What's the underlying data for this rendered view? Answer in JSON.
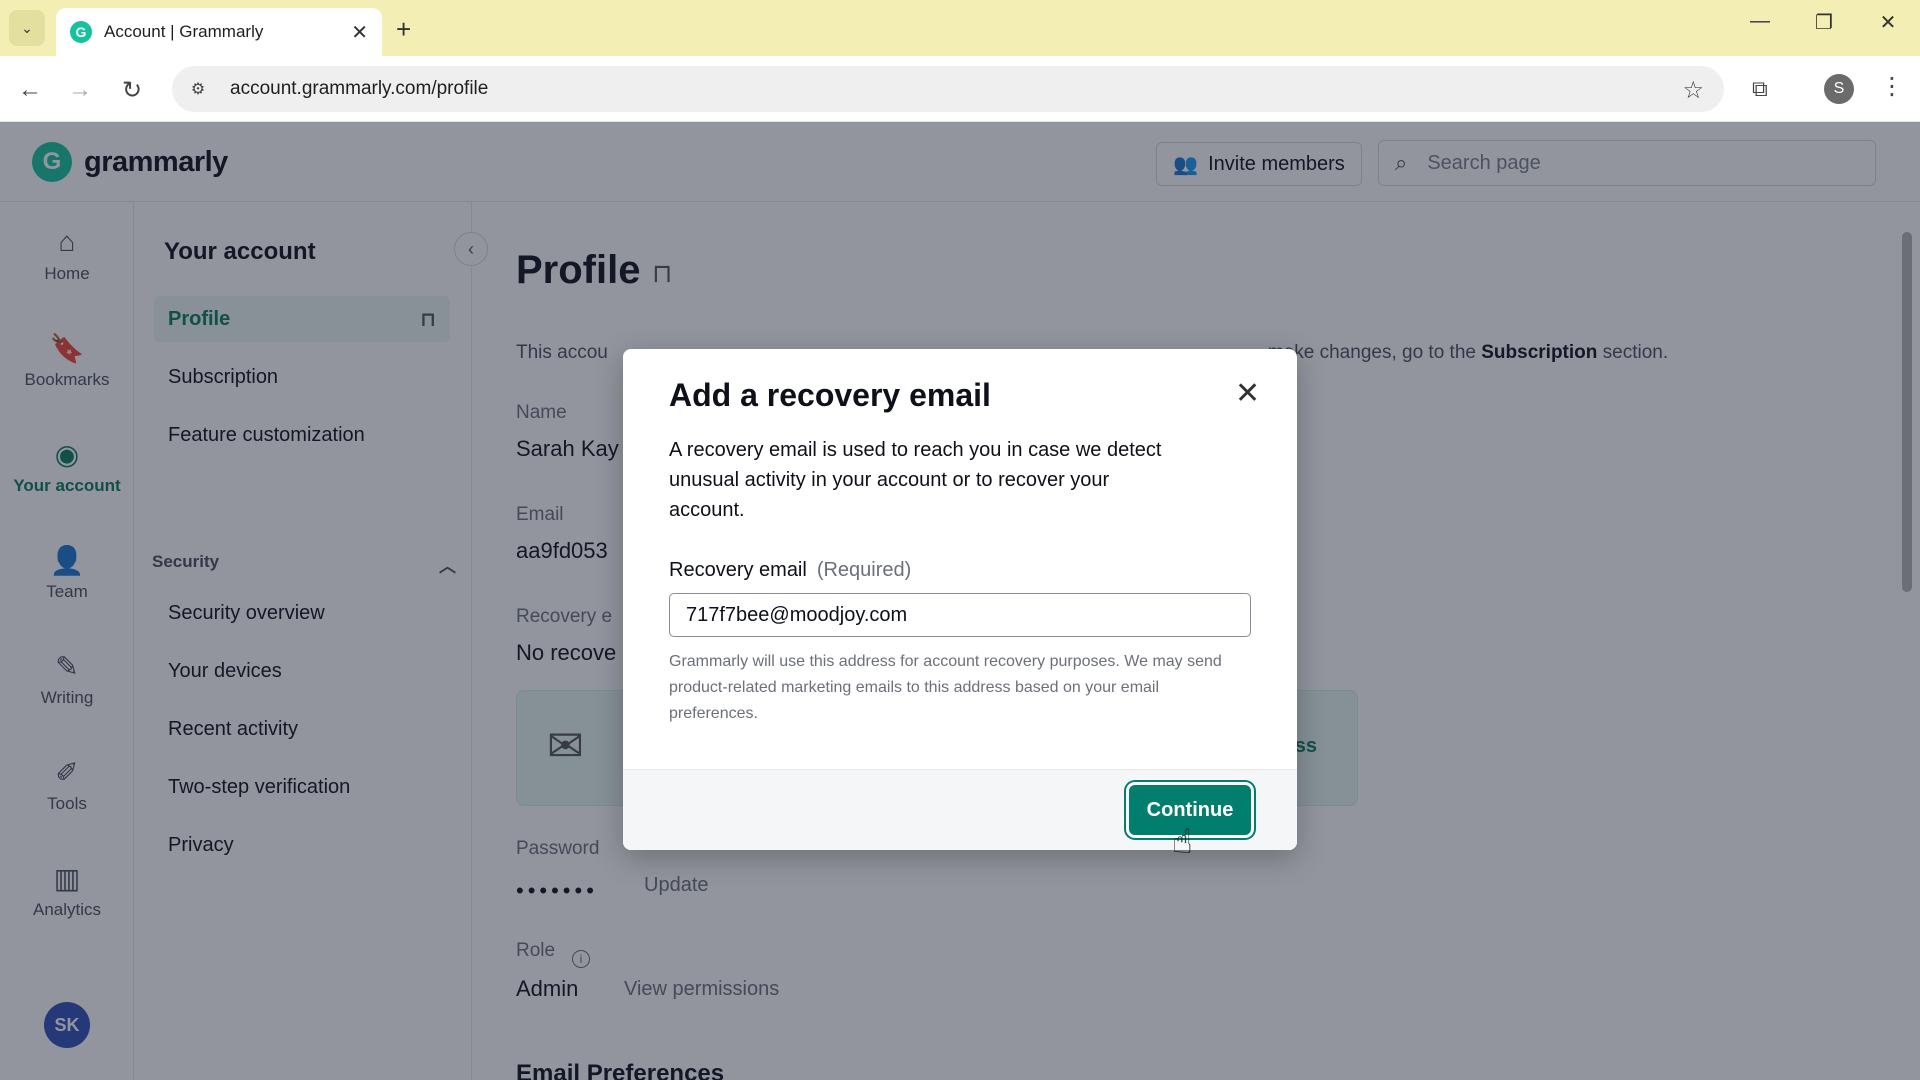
{
  "browser": {
    "tab_title": "Account | Grammarly",
    "favicon_letter": "G",
    "url": "account.grammarly.com/profile",
    "profile_initial": "S"
  },
  "header": {
    "logo_text": "grammarly",
    "logo_letter": "G",
    "invite_label": "Invite members",
    "search_placeholder": "Search page"
  },
  "leftnav": {
    "items": [
      {
        "label": "Home",
        "icon": "home-icon"
      },
      {
        "label": "Bookmarks",
        "icon": "bookmark-icon"
      },
      {
        "label": "Your account",
        "icon": "account-icon",
        "active": true
      },
      {
        "label": "Team",
        "icon": "team-icon"
      },
      {
        "label": "Writing",
        "icon": "writing-icon"
      },
      {
        "label": "Tools",
        "icon": "tools-icon"
      },
      {
        "label": "Analytics",
        "icon": "analytics-icon"
      }
    ],
    "avatar": "SK"
  },
  "subnav": {
    "heading": "Your account",
    "items": [
      "Profile",
      "Subscription",
      "Feature customization"
    ],
    "group_label": "Security",
    "security_items": [
      "Security overview",
      "Your devices",
      "Recent activity",
      "Two-step verification",
      "Privacy"
    ]
  },
  "main": {
    "title": "Profile",
    "desc_start": "This accou",
    "desc_end": "make changes, go to the",
    "desc_link": "Subscription",
    "desc_tail": "section.",
    "name_label": "Name",
    "name_value": "Sarah Kay",
    "email_label": "Email",
    "email_value": "aa9fd053",
    "recovery_label": "Recovery e",
    "recovery_value": "No recove",
    "banner_tail": "ss",
    "password_label": "Password",
    "password_dots": "•••••••",
    "update_link": "Update",
    "role_label": "Role",
    "role_value": "Admin",
    "view_permissions": "View permissions",
    "section_peek": "Email Preferences"
  },
  "modal": {
    "title": "Add a recovery email",
    "intro": "A recovery email is used to reach you in case we detect unusual activity in your account or to recover your account.",
    "input_label": "Recovery email",
    "input_required": "(Required)",
    "input_value": "717f7bee@moodjoy.com",
    "fine_print": "Grammarly will use this address for account recovery purposes. We may send product-related marketing emails to this address based on your email preferences.",
    "continue_label": "Continue"
  },
  "colors": {
    "brand": "#15c39a",
    "primary_button": "#027e6f",
    "tabbar": "#f2eeb4"
  }
}
